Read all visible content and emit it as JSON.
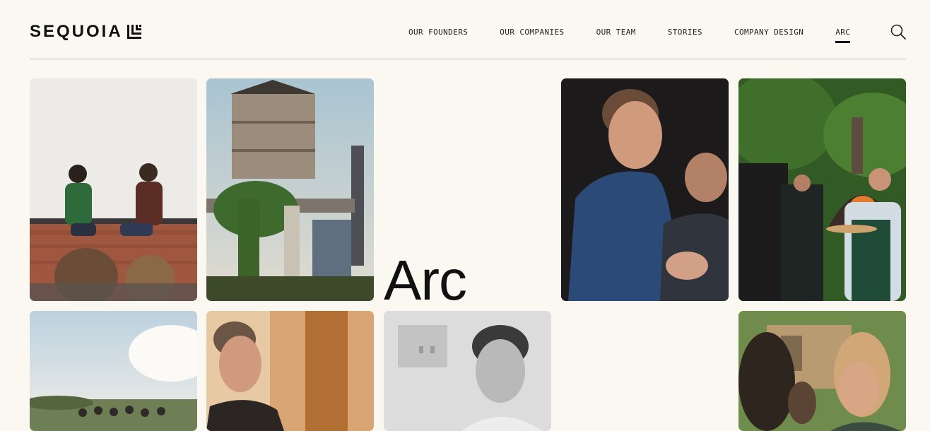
{
  "brand": {
    "name": "SEQUOIA",
    "logo_icon": "sequoia-mark-icon"
  },
  "nav": {
    "items": [
      {
        "label": "OUR FOUNDERS"
      },
      {
        "label": "OUR COMPANIES"
      },
      {
        "label": "OUR TEAM"
      },
      {
        "label": "STORIES"
      },
      {
        "label": "COMPANY DESIGN"
      },
      {
        "label": "ARC",
        "active": true
      }
    ],
    "search_icon": "search-icon"
  },
  "hero": {
    "title": "Arc"
  },
  "gallery": {
    "photos": [
      {
        "name": "photo-fireside-chat"
      },
      {
        "name": "photo-water-tower"
      },
      {
        "name": "photo-speaker-blue-shirt"
      },
      {
        "name": "photo-outdoor-pizza"
      },
      {
        "name": "photo-hillside-group"
      },
      {
        "name": "photo-man-reading"
      },
      {
        "name": "photo-smiling-man-bw"
      },
      {
        "name": "photo-garden-conversation"
      }
    ]
  },
  "colors": {
    "background": "#fbf8f2",
    "text": "#111111",
    "rule": "#bdbab4"
  }
}
